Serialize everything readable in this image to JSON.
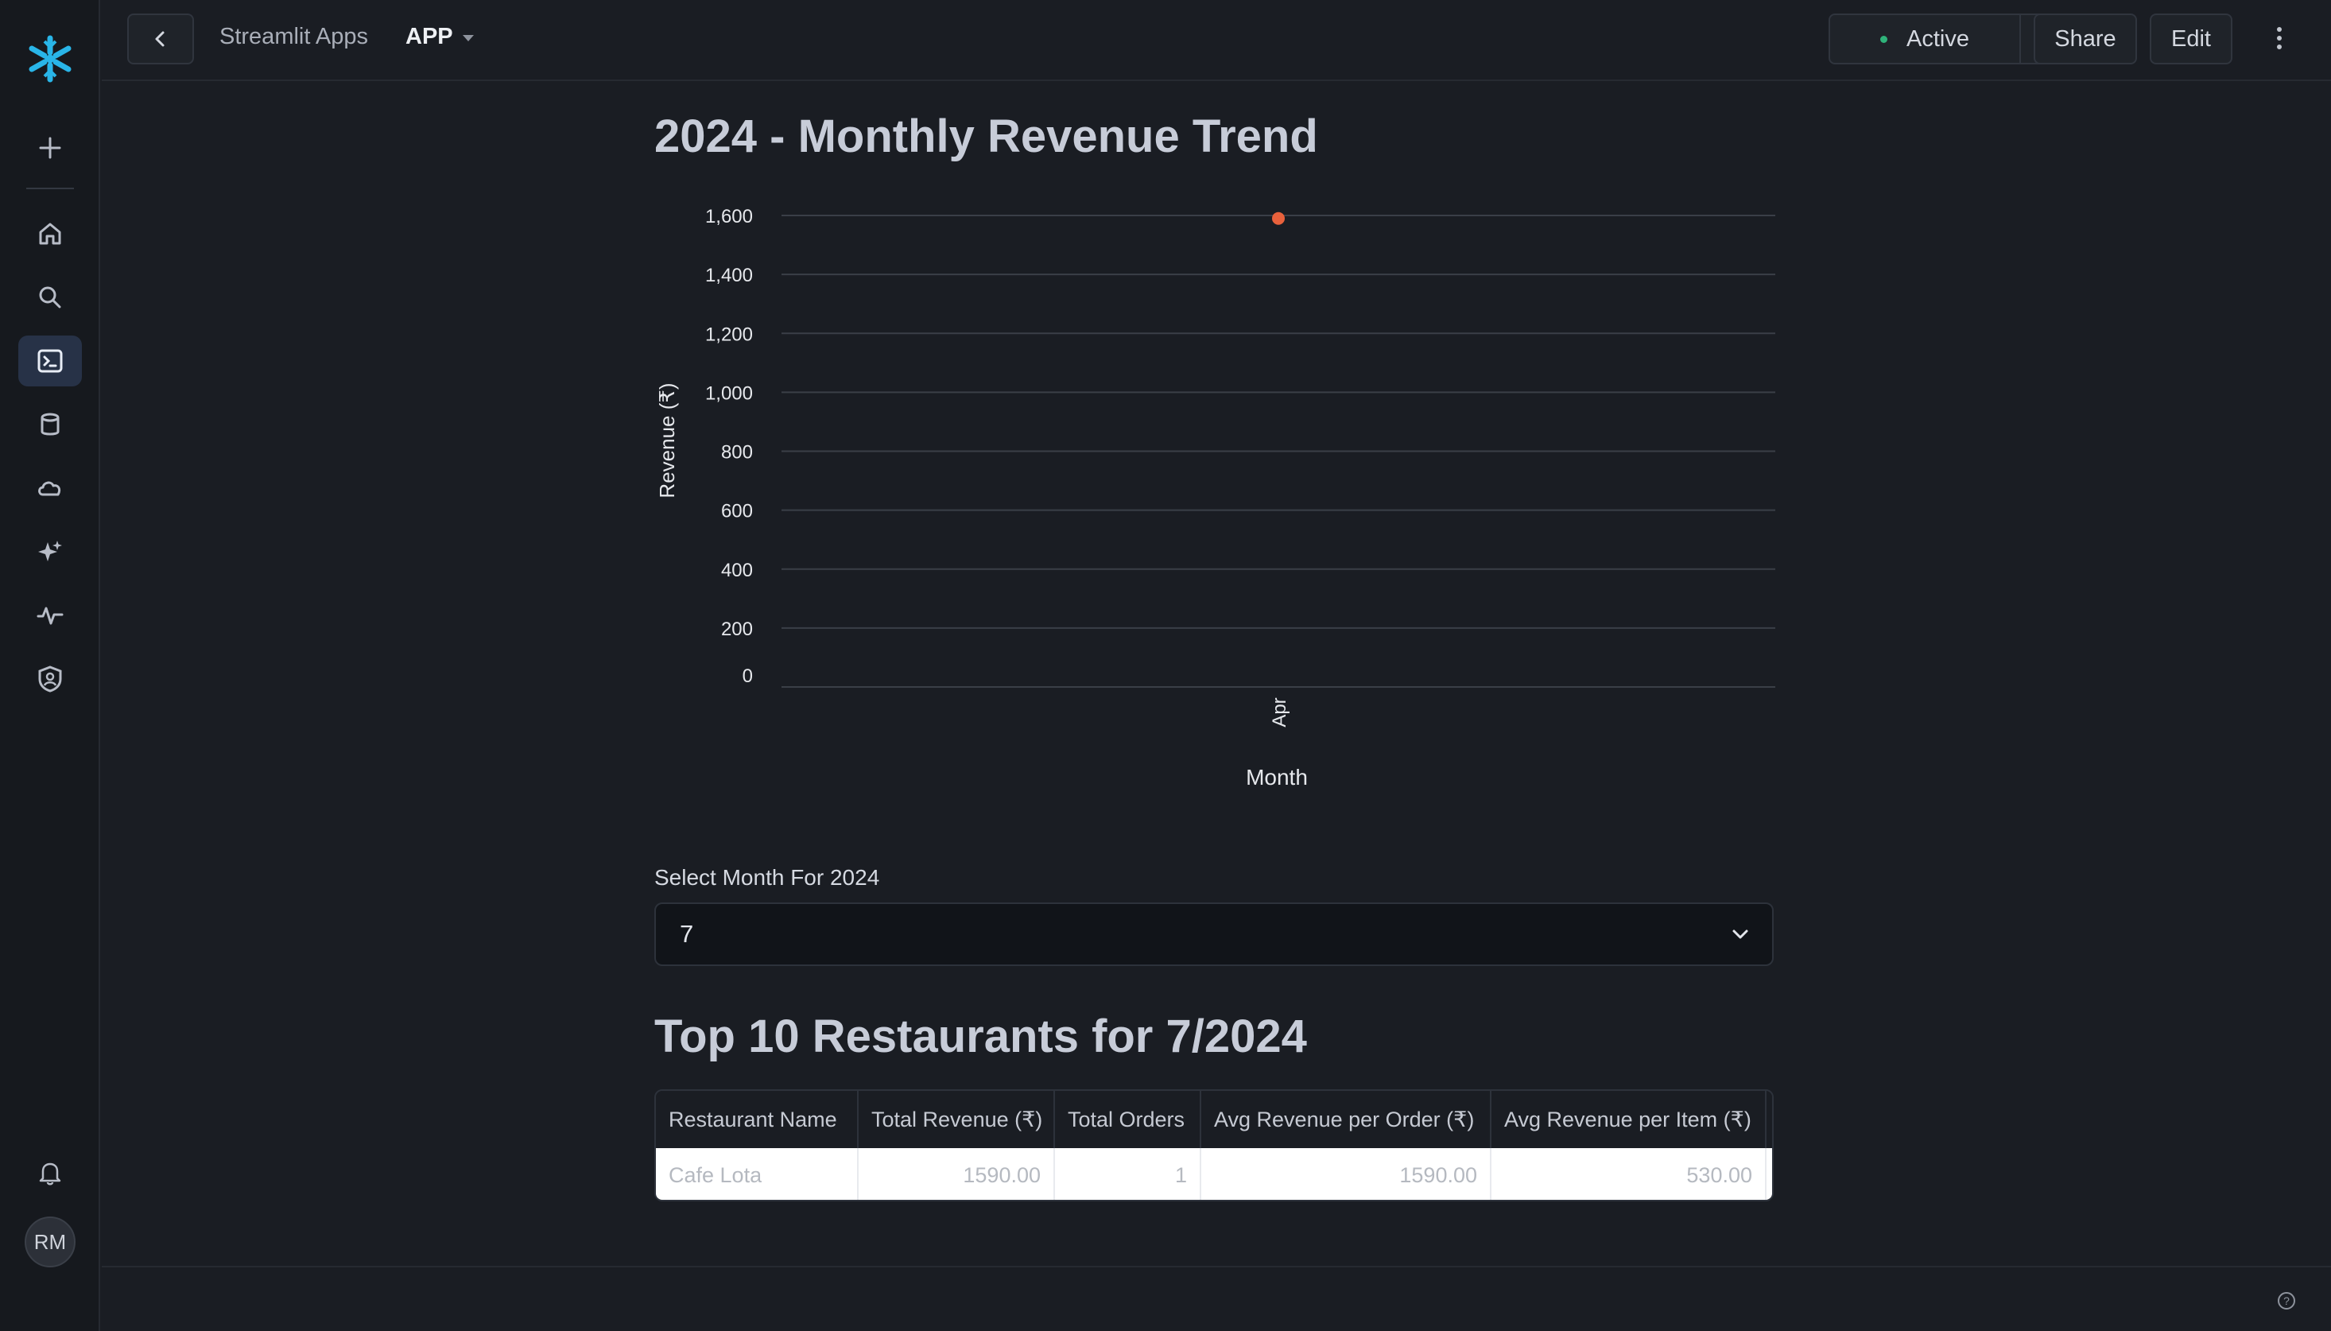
{
  "topbar": {
    "breadcrumb_parent": "Streamlit Apps",
    "breadcrumb_current": "APP",
    "status": "Active",
    "share_label": "Share",
    "edit_label": "Edit"
  },
  "sidebar": {
    "items": [
      "add-icon",
      "home-icon",
      "search-icon",
      "projects-icon",
      "data-icon",
      "cloud-icon",
      "ai-icon",
      "monitoring-icon",
      "admin-icon"
    ],
    "active_item": "projects-icon",
    "user_initials": "RM"
  },
  "main": {
    "chart_title": "2024 - Monthly Revenue Trend",
    "select_label": "Select Month For 2024",
    "select_value": "7",
    "table_title": "Top 10 Restaurants for 7/2024"
  },
  "chart_data": {
    "type": "scatter",
    "x": [
      "Apr"
    ],
    "y": [
      1590
    ],
    "xlabel": "Month",
    "ylabel": "Revenue (₹)",
    "ylim": [
      0,
      1600
    ],
    "yticks": [
      "0",
      "200",
      "400",
      "600",
      "800",
      "1,000",
      "1,200",
      "1,400",
      "1,600"
    ],
    "grid": true,
    "point_color": "#e8613c"
  },
  "table": {
    "columns": [
      "Restaurant Name",
      "Total Revenue (₹)",
      "Total Orders",
      "Avg Revenue per Order (₹)",
      "Avg Revenue per Item (₹)"
    ],
    "rows": [
      [
        "Cafe Lota",
        "1590.00",
        "1",
        "1590.00",
        "530.00"
      ]
    ]
  },
  "colors": {
    "accent_logo": "#29b5e8",
    "status_dot": "#2fb37a"
  }
}
